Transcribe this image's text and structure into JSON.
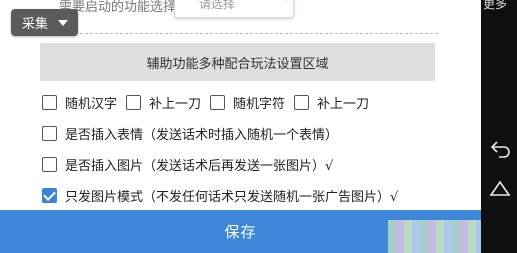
{
  "header": {
    "label": "需要启动的功能选择：",
    "dropdown_value": "请选择"
  },
  "collect_button": {
    "label": "采集"
  },
  "section": {
    "title": "辅助功能多种配合玩法设置区域"
  },
  "options_row1": [
    {
      "label": "随机汉字",
      "checked": false
    },
    {
      "label": "补上一刀",
      "checked": false
    },
    {
      "label": "随机字符",
      "checked": false
    },
    {
      "label": "补上一刀",
      "checked": false
    }
  ],
  "options": [
    {
      "label": "是否插入表情（发送话术时插入随机一个表情）",
      "checked": false
    },
    {
      "label": "是否插入图片（发送话术后再发送一张图片）√",
      "checked": false
    },
    {
      "label": "只发图片模式（不发任何话术只发送随机一张广告图片）√",
      "checked": true
    }
  ],
  "footer": {
    "save_label": "保存"
  },
  "navbar": {
    "top_text": "更多"
  },
  "colors": {
    "accent": "#3d86d8",
    "collect_bg": "#5b5b5b",
    "navbar_bg": "#101010"
  },
  "icons": {
    "back": "back-arrow-icon",
    "home": "home-triangle-icon",
    "dropdown": "chevron-down-icon"
  }
}
